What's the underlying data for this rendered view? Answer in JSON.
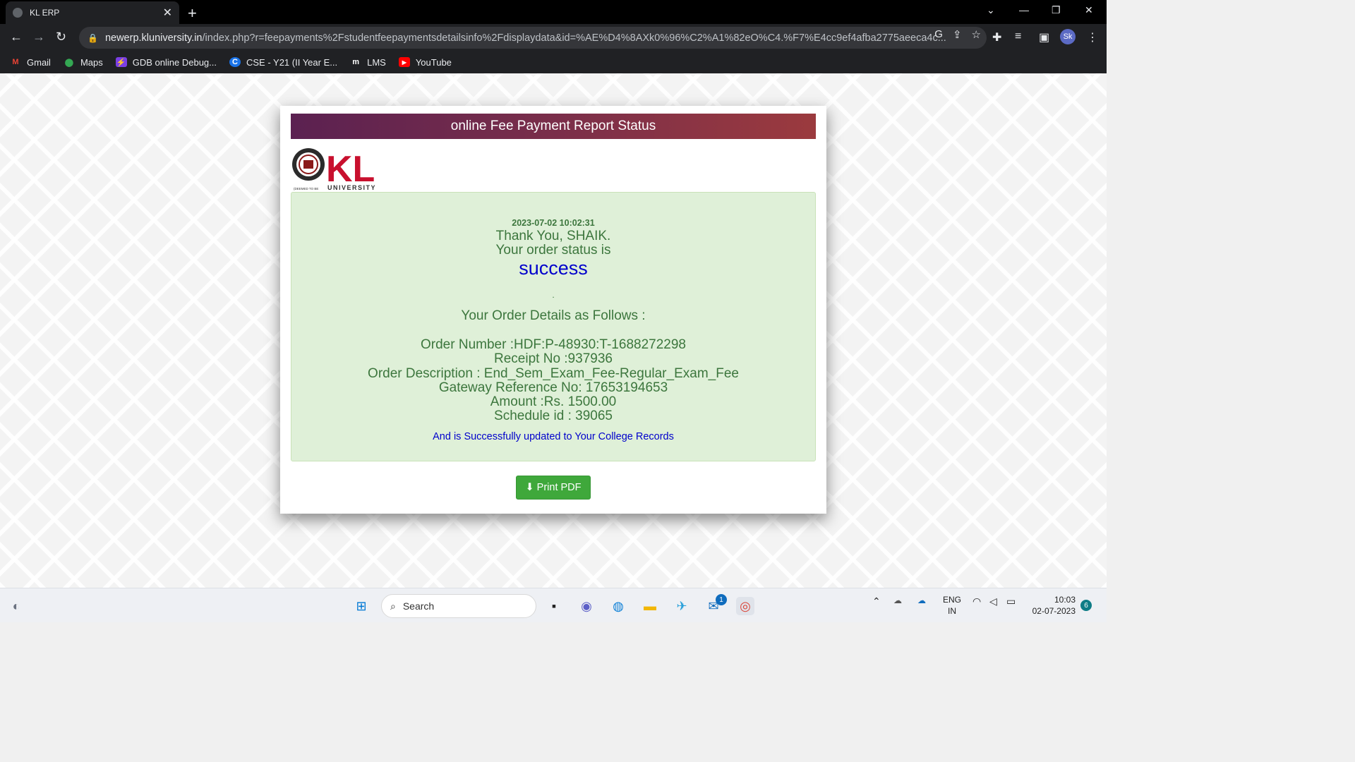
{
  "browser": {
    "tab_title": "KL ERP",
    "url_host": "newerp.kluniversity.in",
    "url_path": "/index.php?r=feepayments%2Fstudentfeepaymentsdetailsinfo%2Fdisplaydata&id=%AE%D4%8AXk0%96%C2%A1%82eO%C4.%F7%E4cc9ef4afba2775aeeca4c...",
    "profile_initials": "Sk"
  },
  "bookmarks": [
    {
      "label": "Gmail",
      "icon": "gmail-icon",
      "color": "#ea4335"
    },
    {
      "label": "Maps",
      "icon": "maps-icon",
      "color": "#34a853"
    },
    {
      "label": "GDB online Debug...",
      "icon": "gdb-icon",
      "color": "#7b3fe4"
    },
    {
      "label": "CSE - Y21 (II Year E...",
      "icon": "c-icon",
      "color": "#1a73e8"
    },
    {
      "label": "LMS",
      "icon": "lms-icon",
      "color": "#ffffff"
    },
    {
      "label": "YouTube",
      "icon": "youtube-icon",
      "color": "#ff0000"
    }
  ],
  "page": {
    "header": "online Fee Payment Report Status",
    "logo_text": "KL",
    "logo_subtext": "UNIVERSITY",
    "logo_tag": "(DEEMED TO BE",
    "timestamp": "2023-07-02 10:02:31",
    "thanks_line": "Thank You, SHAIK.",
    "status_line": "Your order status is",
    "status": "success",
    "dot": ".",
    "details_heading": "Your Order Details as Follows :",
    "details": {
      "order_number": "Order Number :HDF:P-48930:T-1688272298",
      "receipt_no": "Receipt No :937936",
      "order_description": "Order Description : End_Sem_Exam_Fee-Regular_Exam_Fee",
      "gateway_reference": "Gateway Reference No: 17653194653",
      "amount": "Amount :Rs. 1500.00",
      "schedule_id": "Schedule id : 39065"
    },
    "updated_note": "And is Successfully updated to Your College Records",
    "print_button": "Print PDF"
  },
  "taskbar": {
    "search_placeholder": "Search",
    "lang_top": "ENG",
    "lang_bottom": "IN",
    "time": "10:03",
    "date": "02-07-2023",
    "notification_count": "6",
    "mail_badge": "1"
  },
  "colors": {
    "header_gradient_start": "#5b2151",
    "header_gradient_end": "#9b3a3e",
    "success_bg": "#dff0d8",
    "success_text": "#3c763d",
    "status_blue": "#0000cc",
    "button_green": "#3fa83b"
  }
}
